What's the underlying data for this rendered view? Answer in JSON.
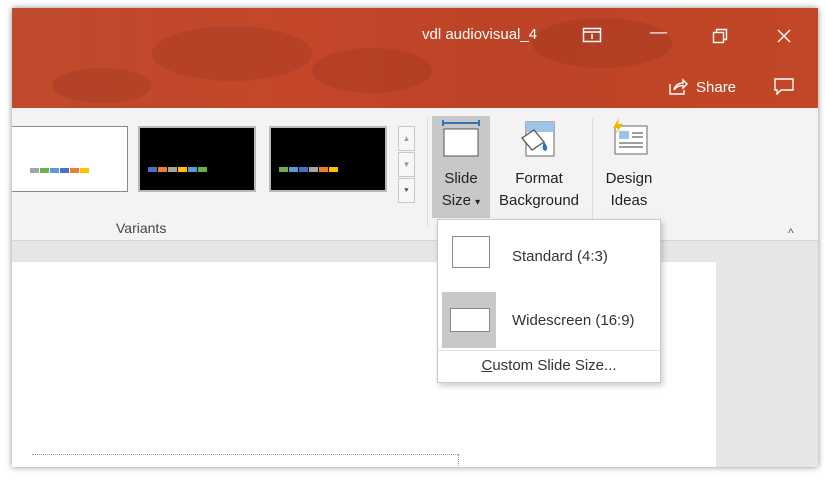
{
  "window": {
    "title": "vdl audiovisual_4",
    "controls": {
      "minimize": "—",
      "restore": "🗗",
      "close": "✕"
    },
    "title_bar_color": "#c4472a"
  },
  "header": {
    "share_label": "Share"
  },
  "ribbon": {
    "variants_label": "Variants",
    "slide_size": {
      "line1": "Slide",
      "line2": "Size",
      "caret": "▾"
    },
    "format_background": {
      "line1": "Format",
      "line2": "Background"
    },
    "design_ideas": {
      "line1": "Design",
      "line2": "Ideas"
    },
    "scroll": {
      "up": "▲",
      "down": "▼",
      "more": "⯆"
    },
    "collapse": "^"
  },
  "variant_swatches": [
    "#4472c4",
    "#ed7d31",
    "#a5a5a5",
    "#ffc000",
    "#5b9bd5",
    "#70ad47"
  ],
  "slide_size_menu": {
    "standard": "Standard (4:3)",
    "widescreen": "Widescreen (16:9)",
    "custom_prefix": "C",
    "custom_rest": "ustom Slide Size...",
    "selected": "widescreen"
  }
}
